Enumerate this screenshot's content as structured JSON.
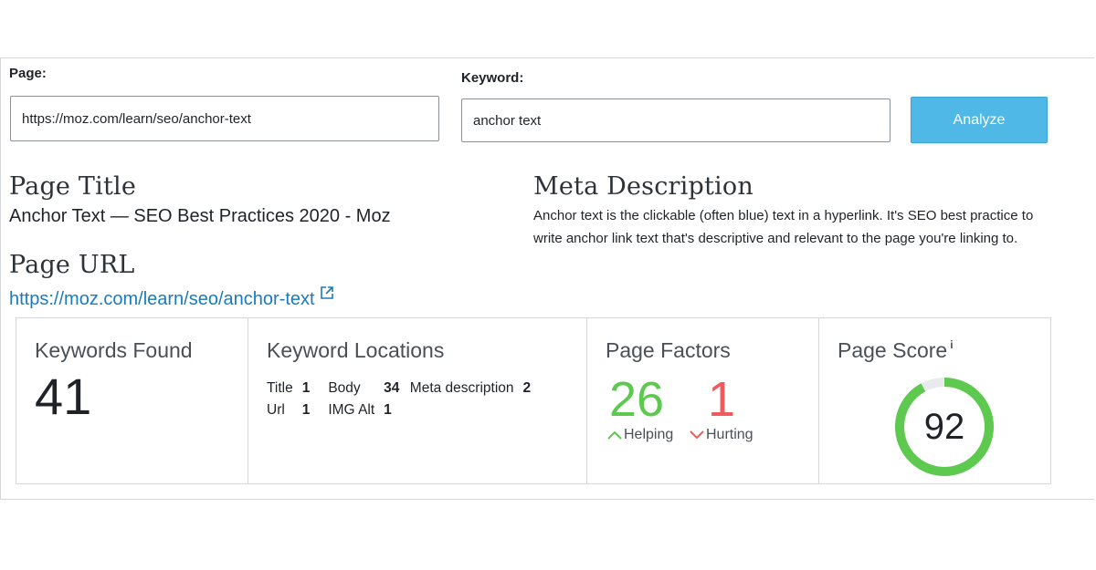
{
  "form": {
    "page_label": "Page:",
    "page_value": "https://moz.com/learn/seo/anchor-text",
    "keyword_label": "Keyword:",
    "keyword_value": "anchor text",
    "analyze_label": "Analyze"
  },
  "page_info": {
    "title_heading": "Page Title",
    "title_value": "Anchor Text — SEO Best Practices 2020 - Moz",
    "url_heading": "Page URL",
    "url_value": "https://moz.com/learn/seo/anchor-text",
    "meta_heading": "Meta Description",
    "meta_value": "Anchor text is the clickable (often blue) text in a hyperlink. It's SEO best practice to write anchor link text that's descriptive and relevant to the page you're linking to."
  },
  "stats": {
    "keywords_found": {
      "title": "Keywords Found",
      "value": "41"
    },
    "keyword_locations": {
      "title": "Keyword Locations",
      "rows": [
        [
          {
            "label": "Title",
            "value": "1"
          },
          {
            "label": "Body",
            "value": "34"
          },
          {
            "label": "Meta description",
            "value": "2"
          }
        ],
        [
          {
            "label": "Url",
            "value": "1"
          },
          {
            "label": "IMG Alt",
            "value": "1"
          }
        ]
      ]
    },
    "page_factors": {
      "title": "Page Factors",
      "helping_value": "26",
      "helping_label": "Helping",
      "hurting_value": "1",
      "hurting_label": "Hurting"
    },
    "page_score": {
      "title": "Page Score",
      "info_mark": "i",
      "value": "92",
      "fraction": 0.92
    }
  },
  "colors": {
    "accent_blue": "#4fb8e6",
    "link_blue": "#1a7bbd",
    "helping_green": "#5ec94f",
    "hurting_red": "#f05a5a",
    "score_green": "#5ec94f",
    "score_track": "#e8eaec"
  },
  "icons": {
    "external_link": "external-link-icon",
    "helping": "chevron-up-icon",
    "hurting": "chevron-down-icon",
    "info": "info-icon"
  }
}
